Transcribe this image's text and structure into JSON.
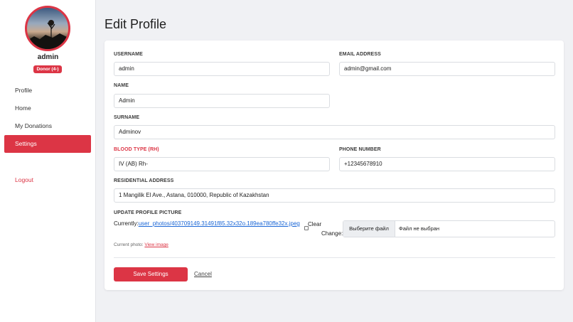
{
  "sidebar": {
    "username": "admin",
    "badge": "Donor (4-)",
    "nav": [
      {
        "label": "Profile",
        "active": false
      },
      {
        "label": "Home",
        "active": false
      },
      {
        "label": "My Donations",
        "active": false
      },
      {
        "label": "Settings",
        "active": true
      }
    ],
    "logout": "Logout"
  },
  "page": {
    "title": "Edit Profile"
  },
  "form": {
    "username": {
      "label": "USERNAME",
      "value": "admin"
    },
    "email": {
      "label": "EMAIL ADDRESS",
      "value": "admin@gmail.com"
    },
    "name": {
      "label": "NAME",
      "value": "Admin"
    },
    "surname": {
      "label": "SURNAME",
      "value": "Adminov"
    },
    "blood_type": {
      "label": "BLOOD TYPE (RH)",
      "value": "IV (AB) Rh-"
    },
    "phone": {
      "label": "PHONE NUMBER",
      "value": "+12345678910"
    },
    "address": {
      "label": "RESIDENTIAL ADDRESS",
      "value": "1 Mangilik El Ave., Astana, 010000, Republic of Kazakhstan"
    },
    "picture": {
      "label": "UPDATE PROFILE PICTURE",
      "currently_label": "Currently:",
      "current_file": "user_photos/403709149.31491f85.32x32o.189ea780ffe32x.jpeg",
      "clear_label": "Clear",
      "change_label": "Change:",
      "choose_button": "Выберите файл",
      "no_file": "Файл не выбран",
      "current_photo_label": "Current photo:",
      "view_link": "View image"
    },
    "save_button": "Save Settings",
    "cancel_link": "Cancel"
  },
  "colors": {
    "accent": "#dc3545",
    "link": "#1a66d6"
  }
}
